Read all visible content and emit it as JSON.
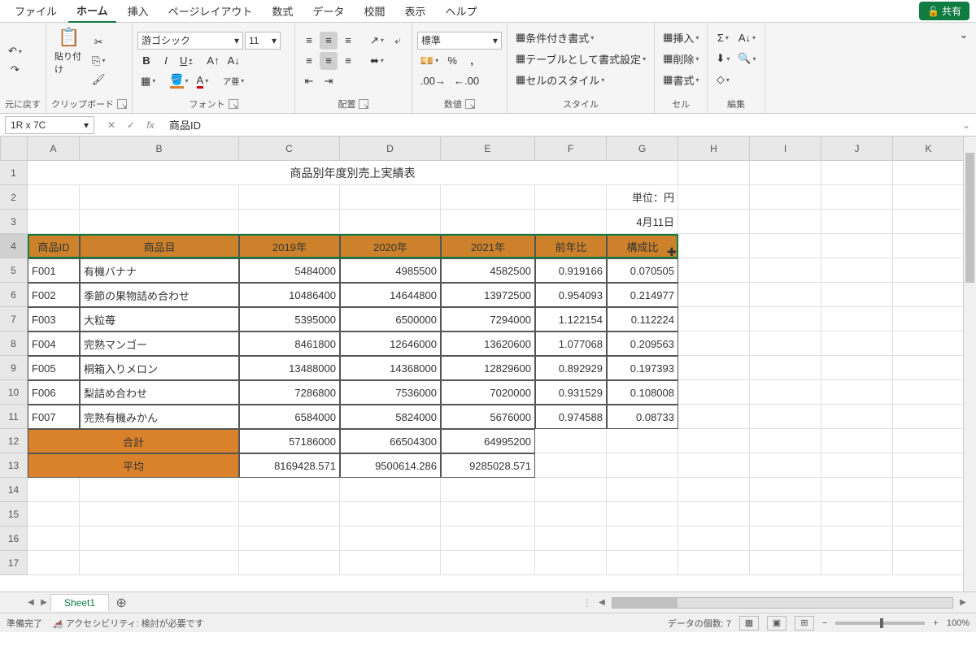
{
  "menu": {
    "items": [
      "ファイル",
      "ホーム",
      "挿入",
      "ページレイアウト",
      "数式",
      "データ",
      "校閲",
      "表示",
      "ヘルプ"
    ],
    "active": "ホーム",
    "share": "共有"
  },
  "ribbon": {
    "undo_label": "元に戻す",
    "clipboard": {
      "paste": "貼り付け",
      "label": "クリップボード"
    },
    "font": {
      "name": "游ゴシック",
      "size": "11",
      "bold": "B",
      "italic": "I",
      "underline": "U",
      "label": "フォント"
    },
    "alignment": {
      "label": "配置"
    },
    "number": {
      "format": "標準",
      "label": "数値"
    },
    "styles": {
      "conditional": "条件付き書式",
      "table": "テーブルとして書式設定",
      "cell": "セルのスタイル",
      "label": "スタイル"
    },
    "cells": {
      "insert": "挿入",
      "delete": "削除",
      "format": "書式",
      "label": "セル"
    },
    "editing": {
      "label": "編集"
    }
  },
  "formula_bar": {
    "namebox": "1R x 7C",
    "formula": "商品ID"
  },
  "sheet": {
    "title": "商品別年度別売上実績表",
    "unit_label": "単位：円",
    "date_label": "4月11日",
    "columns": [
      "A",
      "B",
      "C",
      "D",
      "E",
      "F",
      "G",
      "H",
      "I",
      "J",
      "K"
    ],
    "headers": [
      "商品ID",
      "商品目",
      "2019年",
      "2020年",
      "2021年",
      "前年比",
      "構成比"
    ],
    "rows": [
      {
        "id": "F001",
        "name": "有機バナナ",
        "y2019": "5484000",
        "y2020": "4985500",
        "y2021": "4582500",
        "ratio": "0.919166",
        "comp": "0.070505"
      },
      {
        "id": "F002",
        "name": "季節の果物詰め合わせ",
        "y2019": "10486400",
        "y2020": "14644800",
        "y2021": "13972500",
        "ratio": "0.954093",
        "comp": "0.214977"
      },
      {
        "id": "F003",
        "name": "大粒苺",
        "y2019": "5395000",
        "y2020": "6500000",
        "y2021": "7294000",
        "ratio": "1.122154",
        "comp": "0.112224"
      },
      {
        "id": "F004",
        "name": "完熟マンゴー",
        "y2019": "8461800",
        "y2020": "12646000",
        "y2021": "13620600",
        "ratio": "1.077068",
        "comp": "0.209563"
      },
      {
        "id": "F005",
        "name": "桐箱入りメロン",
        "y2019": "13488000",
        "y2020": "14368000",
        "y2021": "12829600",
        "ratio": "0.892929",
        "comp": "0.197393"
      },
      {
        "id": "F006",
        "name": "梨詰め合わせ",
        "y2019": "7286800",
        "y2020": "7536000",
        "y2021": "7020000",
        "ratio": "0.931529",
        "comp": "0.108008"
      },
      {
        "id": "F007",
        "name": "完熟有機みかん",
        "y2019": "6584000",
        "y2020": "5824000",
        "y2021": "5676000",
        "ratio": "0.974588",
        "comp": "0.08733"
      }
    ],
    "total": {
      "label": "合計",
      "y2019": "57186000",
      "y2020": "66504300",
      "y2021": "64995200"
    },
    "avg": {
      "label": "平均",
      "y2019": "8169428.571",
      "y2020": "9500614.286",
      "y2021": "9285028.571"
    }
  },
  "tabs": {
    "sheet1": "Sheet1"
  },
  "status": {
    "ready": "準備完了",
    "accessibility": "アクセシビリティ: 検討が必要です",
    "count": "データの個数: 7",
    "zoom": "100%"
  }
}
